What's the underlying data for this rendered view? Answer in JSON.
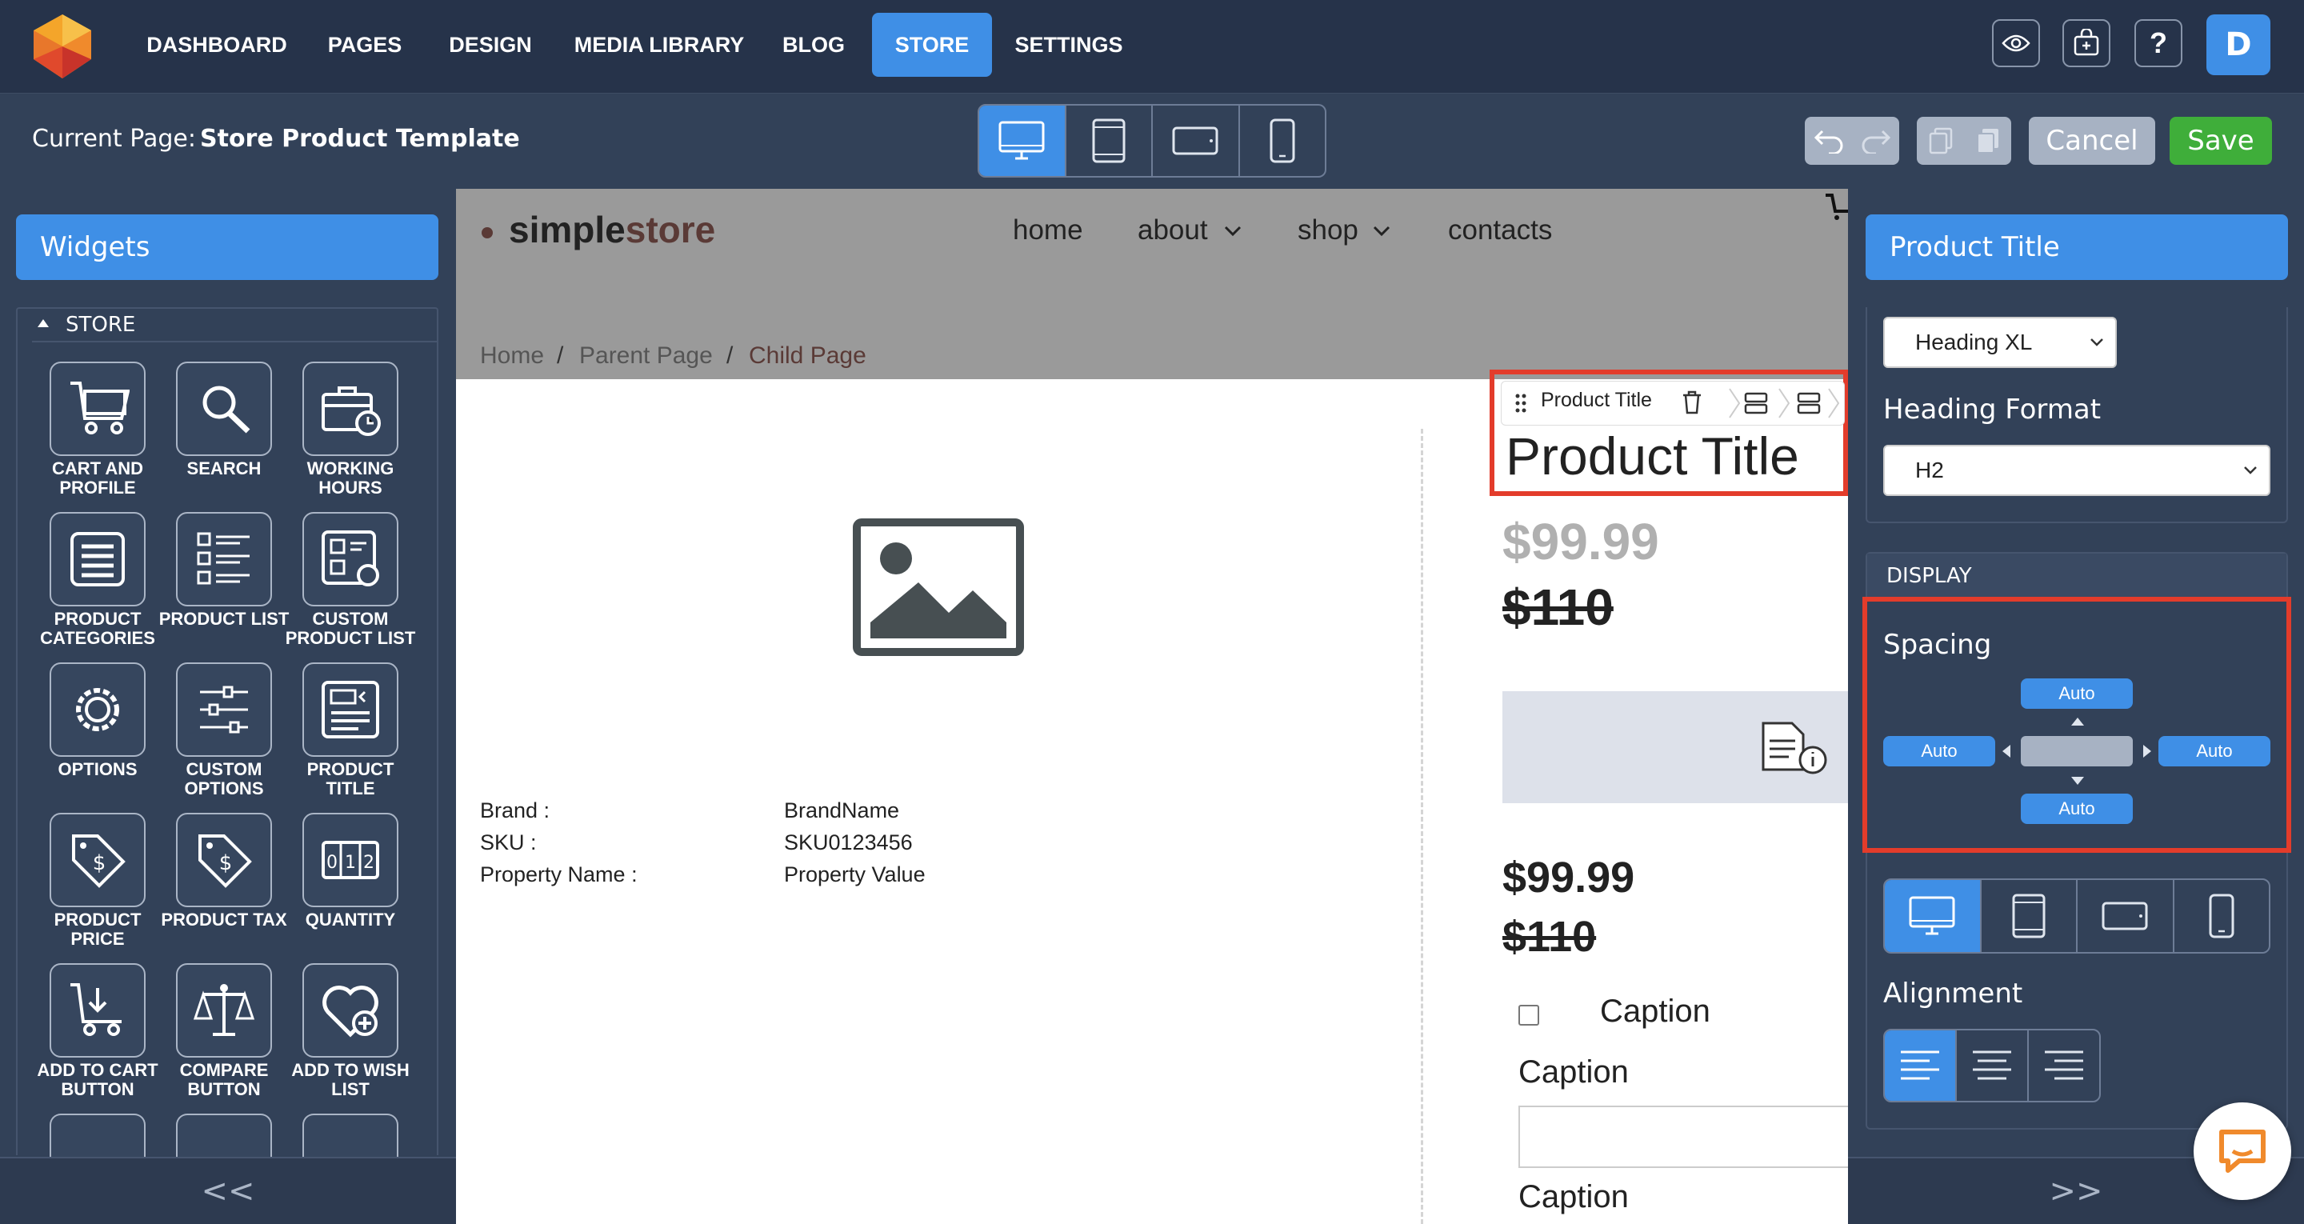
{
  "nav": {
    "items": [
      "DASHBOARD",
      "PAGES",
      "DESIGN",
      "MEDIA LIBRARY",
      "BLOG",
      "STORE",
      "SETTINGS"
    ],
    "active": "STORE",
    "avatar_letter": "D",
    "icons": [
      "eye-icon",
      "store-add-icon",
      "help-icon"
    ]
  },
  "subbar": {
    "current_label": "Current Page:",
    "current_page": "Store Product Template",
    "cancel_label": "Cancel",
    "save_label": "Save"
  },
  "left": {
    "header": "Widgets",
    "section": "STORE",
    "widgets": [
      {
        "label": "CART AND PROFILE",
        "icon": "cart-icon"
      },
      {
        "label": "SEARCH",
        "icon": "search-icon"
      },
      {
        "label": "WORKING HOURS",
        "icon": "briefcase-clock-icon"
      },
      {
        "label": "PRODUCT CATEGORIES",
        "icon": "list-icon"
      },
      {
        "label": "PRODUCT LIST",
        "icon": "product-list-icon"
      },
      {
        "label": "CUSTOM PRODUCT LIST",
        "icon": "custom-list-icon"
      },
      {
        "label": "OPTIONS",
        "icon": "gear-icon"
      },
      {
        "label": "CUSTOM OPTIONS",
        "icon": "sliders-icon"
      },
      {
        "label": "PRODUCT TITLE",
        "icon": "title-icon"
      },
      {
        "label": "PRODUCT PRICE",
        "icon": "price-tag-icon"
      },
      {
        "label": "PRODUCT TAX",
        "icon": "tax-tag-icon"
      },
      {
        "label": "QUANTITY",
        "icon": "quantity-icon"
      },
      {
        "label": "ADD TO CART BUTTON",
        "icon": "add-to-cart-icon"
      },
      {
        "label": "COMPARE BUTTON",
        "icon": "scale-icon"
      },
      {
        "label": "ADD TO WISH LIST",
        "icon": "heart-plus-icon"
      }
    ],
    "collapse_label": "<<"
  },
  "site": {
    "brand_a": "simple",
    "brand_b": "store",
    "menu": [
      "home",
      "about",
      "shop",
      "contacts"
    ],
    "breadcrumbs": [
      "Home",
      "Parent Page",
      "Child Page"
    ],
    "props": [
      {
        "name": "Brand :",
        "value": "BrandName"
      },
      {
        "name": "SKU :",
        "value": "SKU0123456"
      },
      {
        "name": "Property Name :",
        "value": "Property Value"
      }
    ],
    "toolbar_label": "Product Title",
    "product_title": "Product Title",
    "price": "$99.99",
    "old_price": "$110",
    "price2": "$99.99",
    "old_price2": "$110",
    "captions": [
      "Caption",
      "Caption",
      "Caption"
    ]
  },
  "right": {
    "header": "Product Title",
    "heading_size": "Heading XL",
    "format_label": "Heading Format",
    "format_value": "H2",
    "display_label": "DISPLAY",
    "spacing_label": "Spacing",
    "spacing": {
      "top": "Auto",
      "left": "Auto",
      "right": "Auto",
      "bottom": "Auto"
    },
    "alignment_label": "Alignment",
    "expand_label": ">>"
  },
  "colors": {
    "accent": "#3f8fe6",
    "save": "#3fae3a",
    "highlight": "#e33c2b",
    "nav_bg": "#26334a",
    "panel_bg": "#324158"
  }
}
